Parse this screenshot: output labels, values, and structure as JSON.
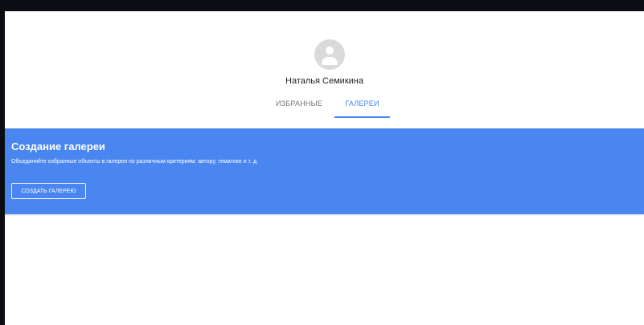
{
  "profile": {
    "avatar_icon": "person-icon",
    "name": "Наталья Семикина"
  },
  "tabs": [
    {
      "label": "ИЗБРАННЫЕ",
      "active": false
    },
    {
      "label": "ГАЛЕРЕИ",
      "active": true
    }
  ],
  "banner": {
    "title": "Создание галереи",
    "description": "Объединяйте избранные объекты в галереи по различным критериям: автору, тематике и т. д.",
    "button_label": "СОЗДАТЬ ГАЛЕРЕЮ"
  },
  "colors": {
    "accent": "#4285f4",
    "banner": "#4a86f0"
  }
}
